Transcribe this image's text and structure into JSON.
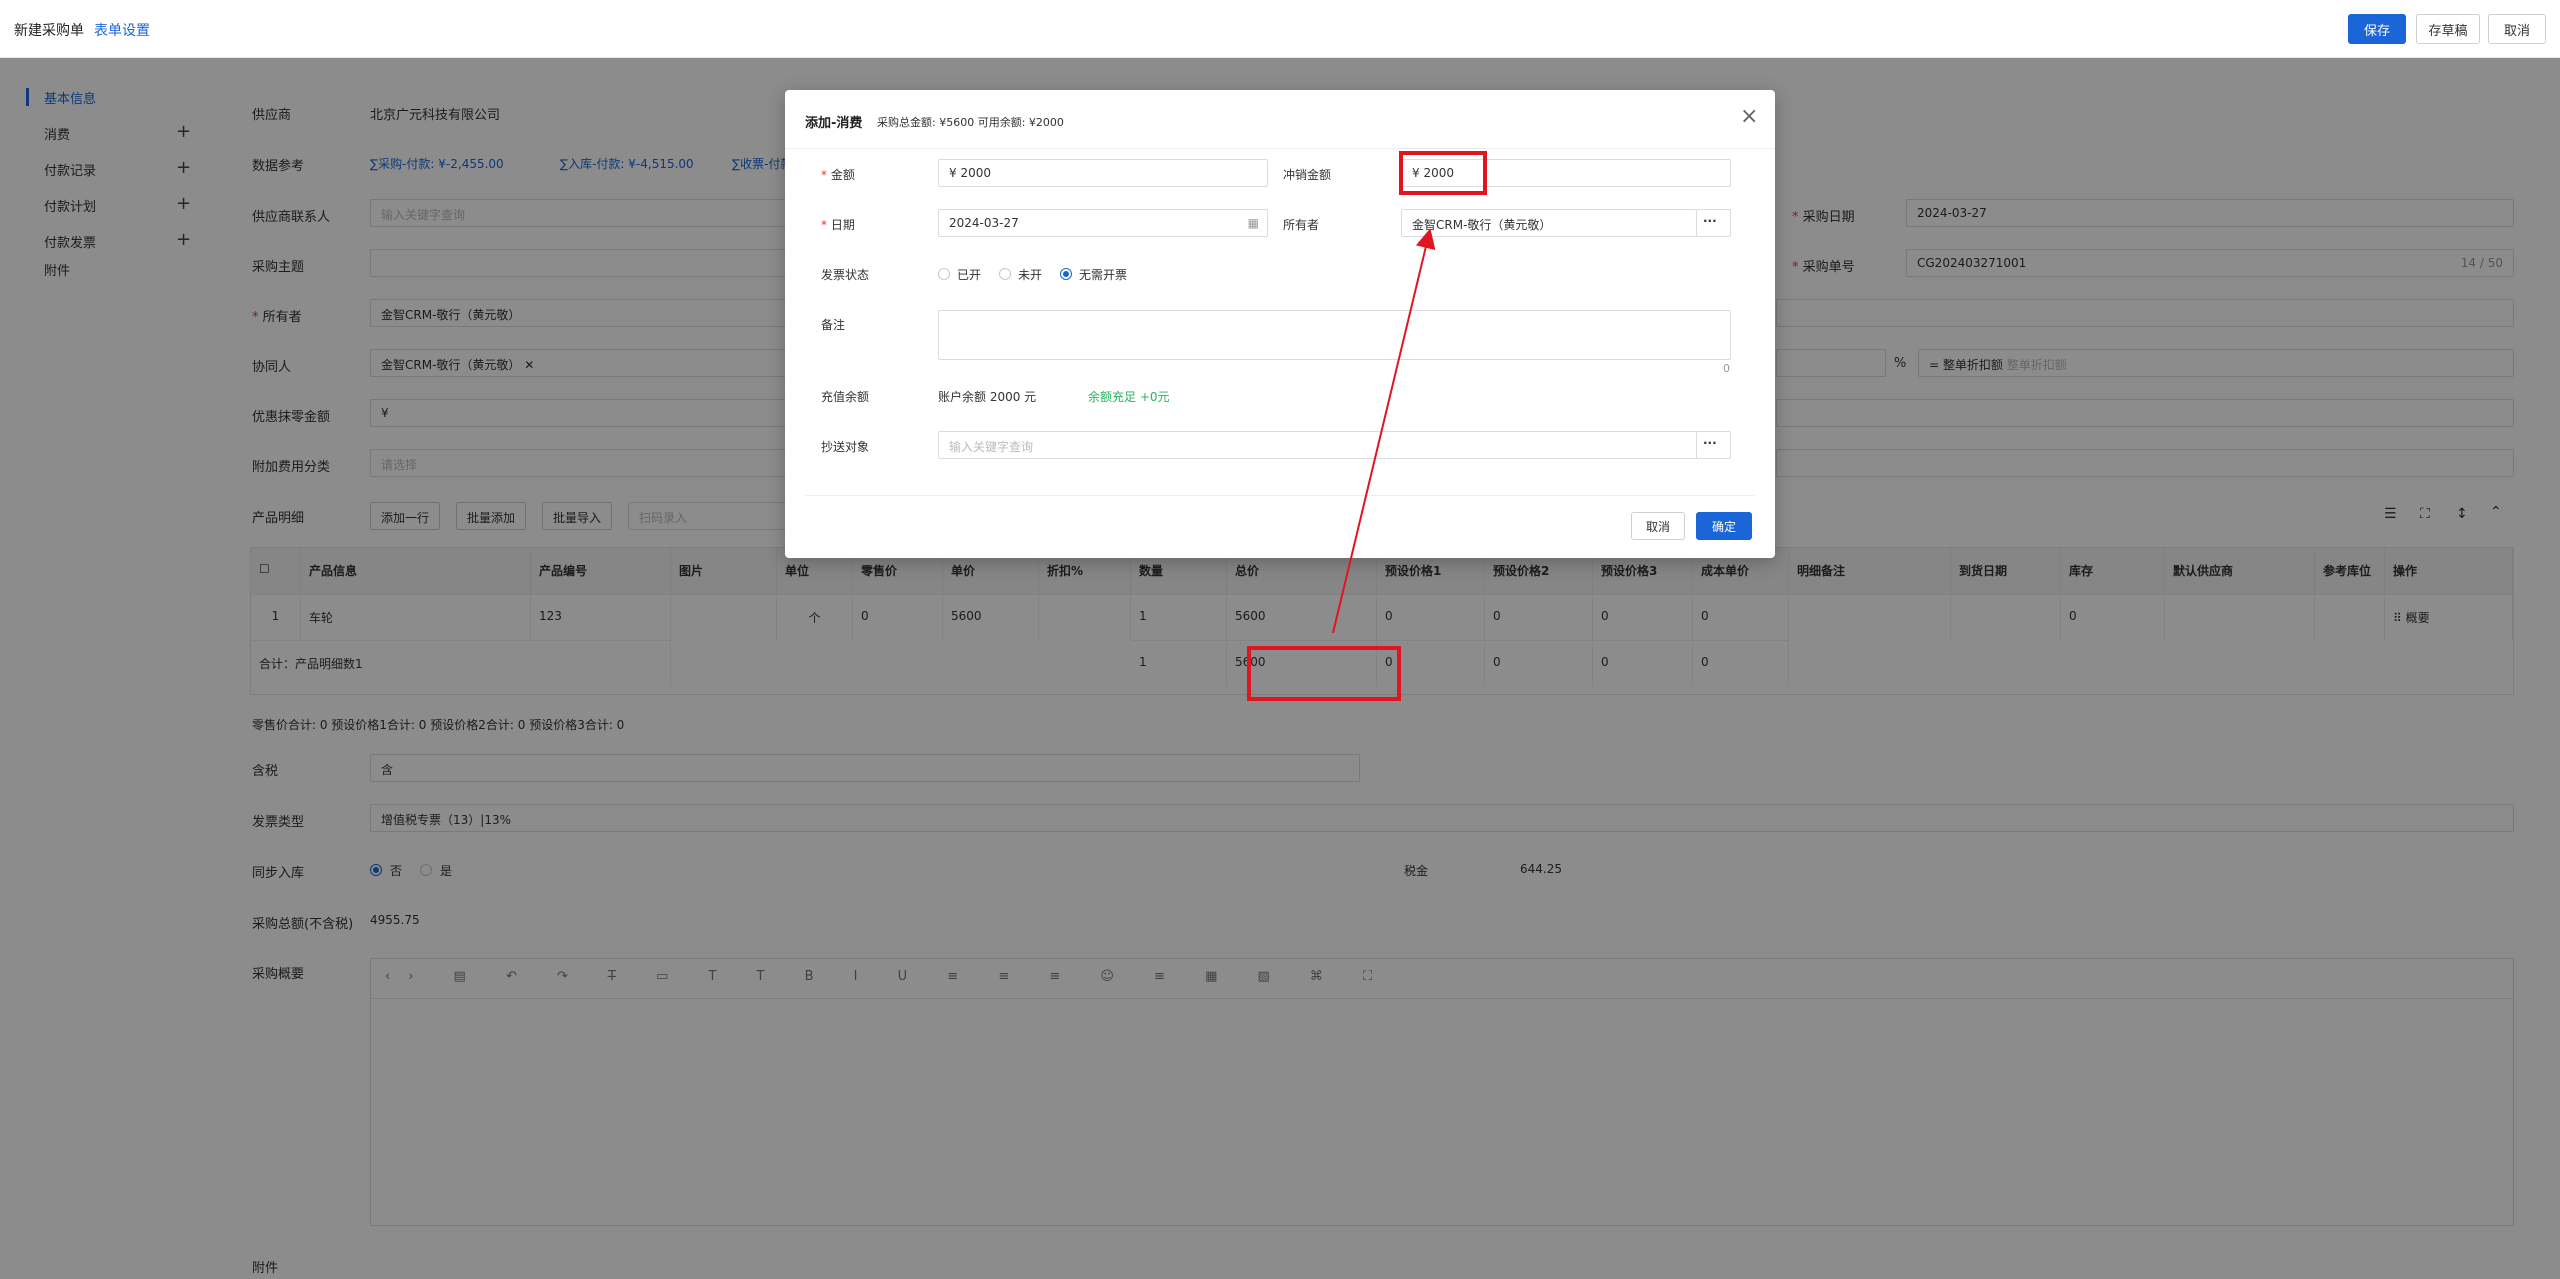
{
  "header": {
    "title": "新建采购单",
    "form_settings": "表单设置",
    "save": "保存",
    "draft": "存草稿",
    "cancel": "取消"
  },
  "nav": {
    "items": [
      {
        "label": "基本信息",
        "plus": ""
      },
      {
        "label": "消费",
        "plus": "+"
      },
      {
        "label": "付款记录",
        "plus": "+"
      },
      {
        "label": "付款计划",
        "plus": "+"
      },
      {
        "label": "付款发票",
        "plus": "+"
      },
      {
        "label": "附件",
        "plus": ""
      }
    ]
  },
  "form": {
    "supplier_label": "供应商",
    "supplier_value": "北京广元科技有限公司",
    "ref_label": "数据参考",
    "ref_1": "∑采购-付款: ¥-2,455.00",
    "ref_2": "∑入库-付款: ¥-4,515.00",
    "ref_3": "∑收票-付款",
    "contact_label": "供应商联系人",
    "contact_placeholder": "输入关键字查询",
    "subject_label": "采购主题",
    "owner_label": "所有者",
    "owner_value": "金智CRM-敬行（黄元敬）",
    "collab_label": "协同人",
    "collab_value": "金智CRM-敬行（黄元敬）",
    "discount_label": "优惠抹零金额",
    "discount_value": "¥",
    "extra_label": "附加费用分类",
    "extra_placeholder": "请选择",
    "product_label": "产品明细",
    "add_row": "添加一行",
    "batch_add": "批量添加",
    "batch_import": "批量导入",
    "scan_placeholder": "扫码录入",
    "purchase_date_label": "采购日期",
    "purchase_date_value": "2024-03-27",
    "purchase_no_label": "采购单号",
    "purchase_no_value": "CG202403271001",
    "purchase_no_count": "14 / 50",
    "percent_sign": "%",
    "whole_discount_label": "= 整单折扣额",
    "whole_discount_placeholder": "整单折扣额",
    "summary_line": "零售价合计: 0  预设价格1合计: 0  预设价格2合计: 0  预设价格3合计: 0",
    "tax_label": "含税",
    "tax_value": "含",
    "invoice_type_label": "发票类型",
    "invoice_type_value": "增值税专票（13）|13%",
    "sync_label": "同步入库",
    "sync_no": "否",
    "sync_yes": "是",
    "tax_amount_label": "税金",
    "tax_amount_value": "644.25",
    "total_ex_label": "采购总额(不含税)",
    "total_ex_value": "4955.75",
    "summary_label": "采购概要",
    "attach_label": "附件"
  },
  "table": {
    "headers": [
      "产品信息",
      "产品编号",
      "图片",
      "单位",
      "零售价",
      "单价",
      "折扣%",
      "数量",
      "总价",
      "预设价格1",
      "预设价格2",
      "预设价格3",
      "成本单价",
      "明细备注",
      "到货日期",
      "库存",
      "默认供应商",
      "参考库位",
      "操作"
    ],
    "row": {
      "index": "1",
      "name": "车轮",
      "code": "123",
      "unit": "个",
      "retail": "0",
      "price": "5600",
      "qty": "1",
      "total": "5600",
      "p1": "0",
      "p2": "0",
      "p3": "0",
      "cost": "0",
      "stock": "0",
      "op": "⠿ 概要"
    },
    "total_row": {
      "label": "合计：产品明细数1",
      "qty": "1",
      "total": "5600",
      "p1": "0",
      "p2": "0",
      "p3": "0",
      "cost": "0"
    }
  },
  "dialog": {
    "title": "添加-消费",
    "subtitle": "采购总金额: ¥5600  可用余额: ¥2000",
    "amount_label": "金额",
    "amount_value": "¥ 2000",
    "offset_label": "冲销金额",
    "offset_value": "¥ 2000",
    "date_label": "日期",
    "date_value": "2024-03-27",
    "owner_label": "所有者",
    "owner_value": "金智CRM-敬行（黄元敬）",
    "invoice_label": "发票状态",
    "invoice_opt1": "已开",
    "invoice_opt2": "未开",
    "invoice_opt3": "无需开票",
    "note_label": "备注",
    "note_count": "0",
    "balance_label": "充值余额",
    "balance_value": "账户余额 2000 元",
    "balance_status": "余额充足 +0元",
    "cc_label": "抄送对象",
    "cc_placeholder": "输入关键字查询",
    "cancel": "取消",
    "confirm": "确定",
    "more": "···"
  },
  "colors": {
    "accent": "#1a66d9",
    "highlight": "#e0151f",
    "success": "#27b35c"
  }
}
